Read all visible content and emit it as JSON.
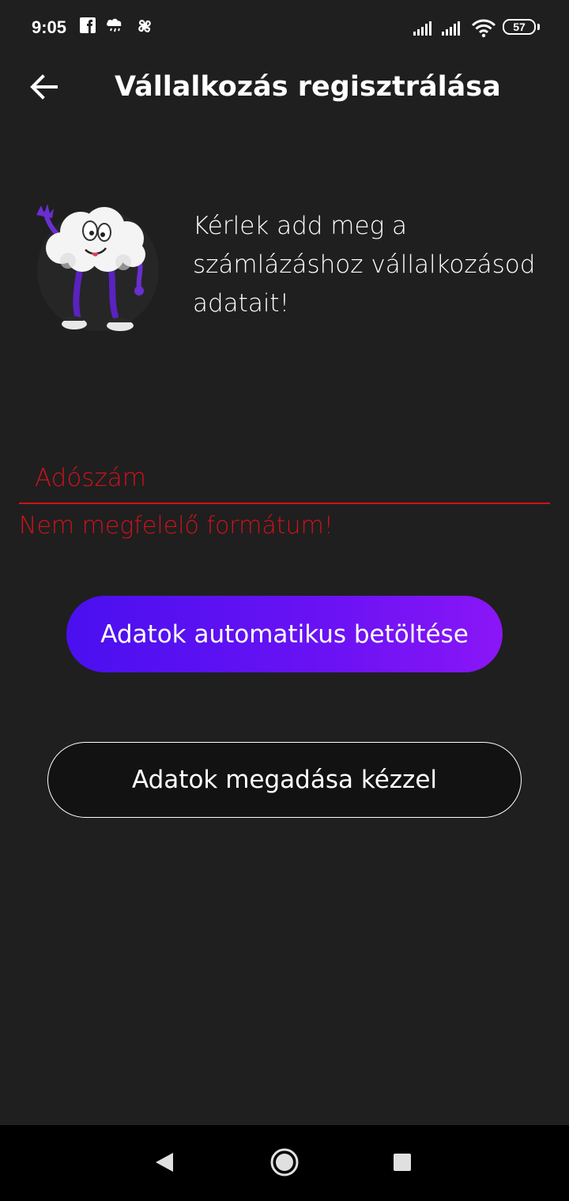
{
  "status_bar": {
    "time": "9:05",
    "battery": "57",
    "icons": [
      "facebook-icon",
      "weather-icon",
      "pinwheel-icon",
      "signal-icon",
      "signal-icon",
      "wifi-icon",
      "battery-icon"
    ]
  },
  "app_bar": {
    "title": "Vállalkozás regisztrálása",
    "back_icon": "arrow-left-icon"
  },
  "intro": {
    "text": "Kérlek add meg a számlázáshoz vállalkozásod adatait!",
    "mascot": "cloud-mascot"
  },
  "tax_field": {
    "placeholder": "Adószám",
    "value": "",
    "error": "Nem megfelelő formátum!"
  },
  "buttons": {
    "auto_load": "Adatok automatikus betöltése",
    "manual_entry": "Adatok megadása kézzel"
  },
  "nav_bar": {
    "icons": [
      "back-triangle-icon",
      "home-circle-icon",
      "recents-square-icon"
    ]
  },
  "colors": {
    "background": "#1f1f1f",
    "error": "#d0121b",
    "accent_start": "#4a10ef",
    "accent_end": "#8a16f6"
  }
}
